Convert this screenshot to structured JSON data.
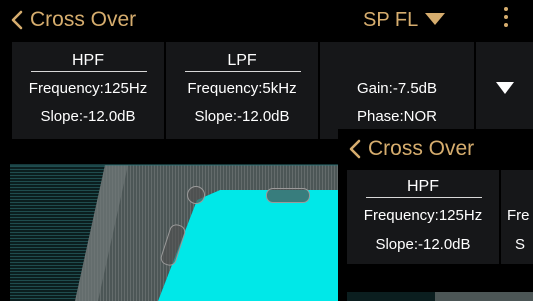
{
  "window_a": {
    "title": "Cross Over",
    "speaker_select": "SP FL",
    "hpf": {
      "header": "HPF",
      "frequency": "Frequency:125Hz",
      "slope": "Slope:-12.0dB"
    },
    "lpf": {
      "header": "LPF",
      "frequency": "Frequency:5kHz",
      "slope": "Slope:-12.0dB"
    },
    "settings": {
      "gain": "Gain:-7.5dB",
      "phase": "Phase:NOR"
    }
  },
  "window_b": {
    "title": "Cross Over",
    "hpf": {
      "header": "HPF",
      "frequency": "Frequency:125Hz",
      "slope": "Slope:-12.0dB"
    },
    "lpf_partial": {
      "frequency": "Fre",
      "slope": "S"
    }
  },
  "colors": {
    "accent_gold": "#d6ad6e",
    "filter_fill": "#00e8e8",
    "panel_bg": "#161719"
  },
  "icons": [
    "back-chevron-icon",
    "dropdown-triangle-icon",
    "more-vertical-icon",
    "expand-triangle-icon",
    "filter-handle-icon"
  ]
}
